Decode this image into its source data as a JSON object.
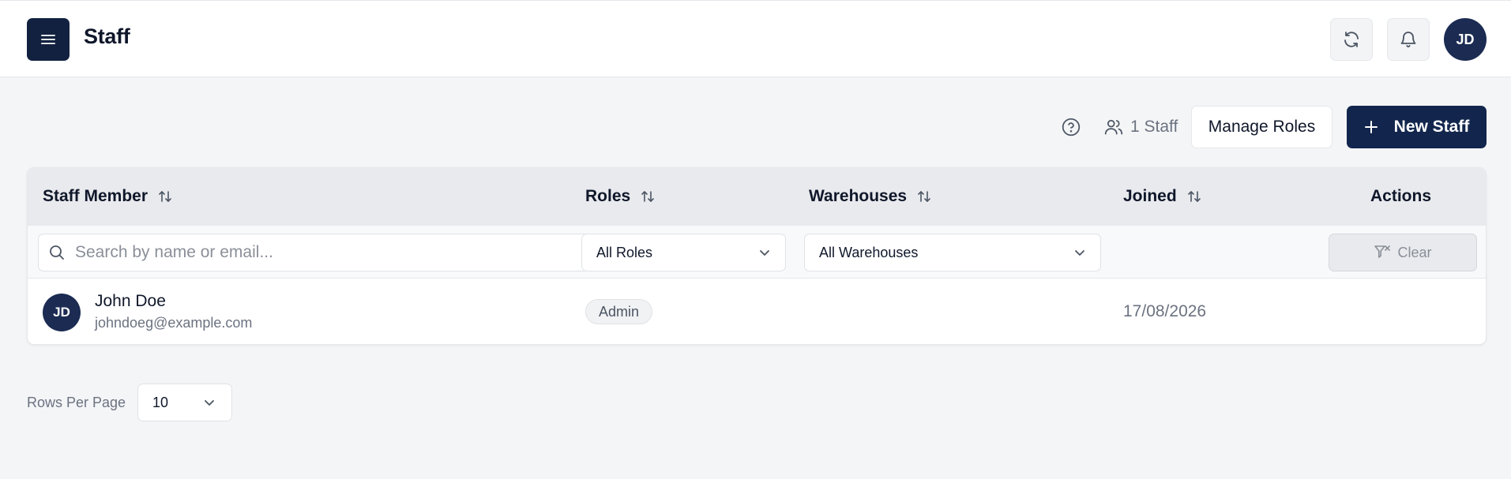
{
  "header": {
    "title": "Staff",
    "user_initials": "JD"
  },
  "toolbar": {
    "staff_count": "1 Staff",
    "manage_roles_label": "Manage Roles",
    "new_staff_label": "New Staff"
  },
  "table": {
    "columns": [
      {
        "label": "Staff Member",
        "sortable": true
      },
      {
        "label": "Roles",
        "sortable": true
      },
      {
        "label": "Warehouses",
        "sortable": true
      },
      {
        "label": "Joined",
        "sortable": true
      },
      {
        "label": "Actions",
        "sortable": false
      }
    ],
    "filters": {
      "search_placeholder": "Search by name or email...",
      "roles_selected": "All Roles",
      "warehouses_selected": "All Warehouses",
      "clear_label": "Clear"
    },
    "rows": [
      {
        "initials": "JD",
        "name": "John Doe",
        "email": "johndoeg@example.com",
        "role": "Admin",
        "warehouses": "",
        "joined": "17/08/2026"
      }
    ]
  },
  "pagination": {
    "rows_per_page_label": "Rows Per Page",
    "rows_per_page_value": "10"
  },
  "colors": {
    "primary": "#12264d",
    "avatar": "#1b2b52",
    "background": "#f4f5f7",
    "header_row": "#e9eaed"
  }
}
